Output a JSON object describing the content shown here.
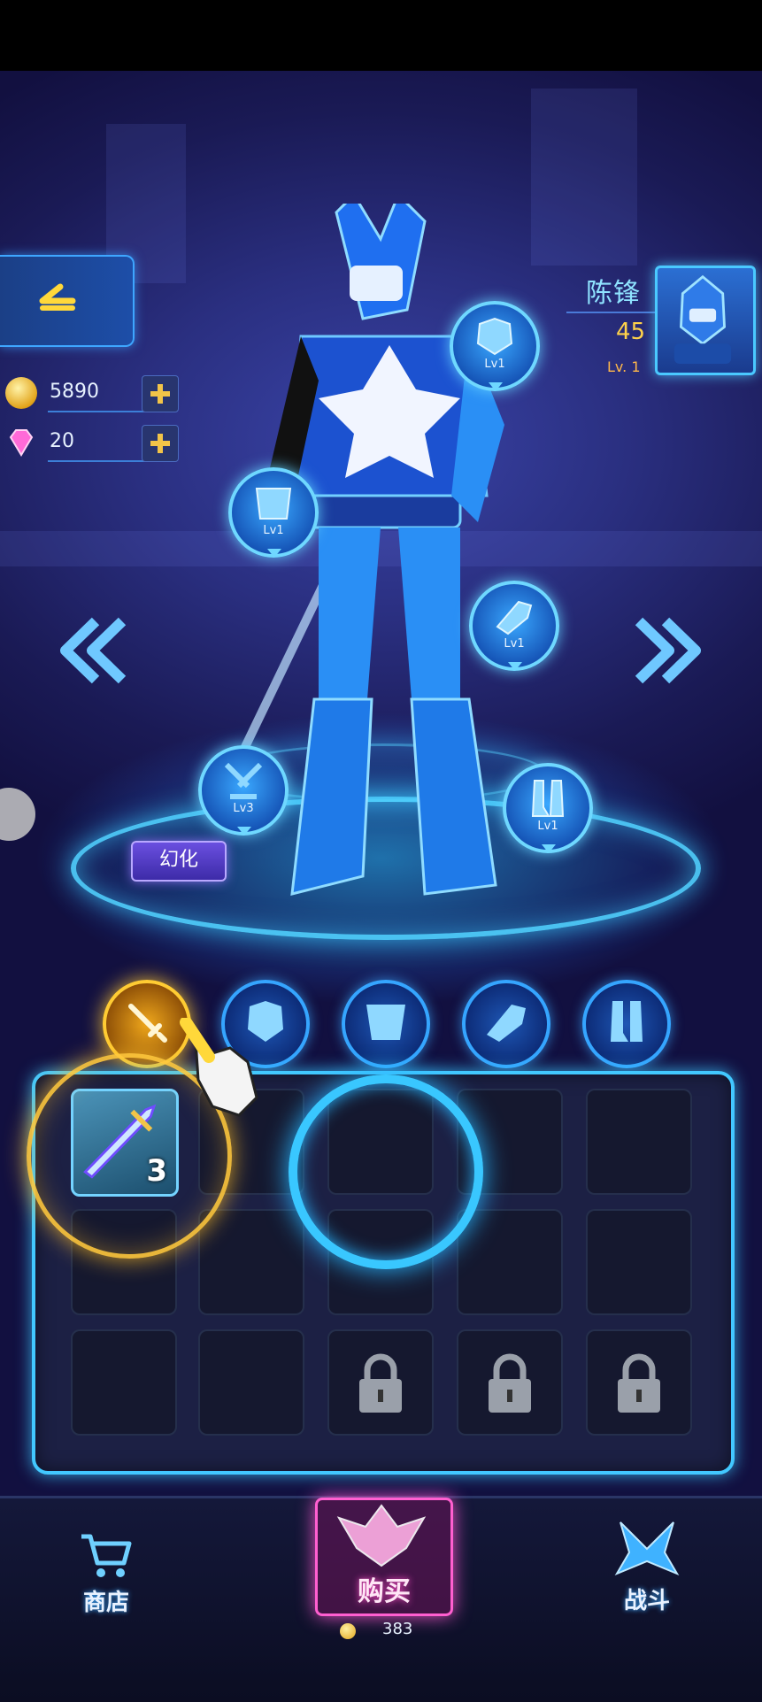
{
  "currency": {
    "gold": "5890",
    "gems": "20",
    "gold_icon": "coin-icon",
    "gem_icon": "gem-icon"
  },
  "player": {
    "name": "陈锋",
    "level_value": "45",
    "level_text": "Lv. 1"
  },
  "equipment": [
    {
      "slot": "helmet",
      "level": "Lv1",
      "icon": "helmet-icon"
    },
    {
      "slot": "armor",
      "level": "Lv1",
      "icon": "armor-icon"
    },
    {
      "slot": "gauntlet",
      "level": "Lv1",
      "icon": "gauntlet-icon"
    },
    {
      "slot": "weapon",
      "level": "Lv3",
      "icon": "sword-icon"
    },
    {
      "slot": "boots",
      "level": "Lv1",
      "icon": "boots-icon"
    }
  ],
  "transform_label": "幻化",
  "inventory": {
    "weapon_quantity": "3"
  },
  "bottom_nav": {
    "shop": "商店",
    "buy": "购买",
    "buy_price": "383",
    "battle": "战斗"
  },
  "colors": {
    "accent": "#42c8ff",
    "gold": "#ffd24a",
    "buy": "#ff5fd0"
  }
}
